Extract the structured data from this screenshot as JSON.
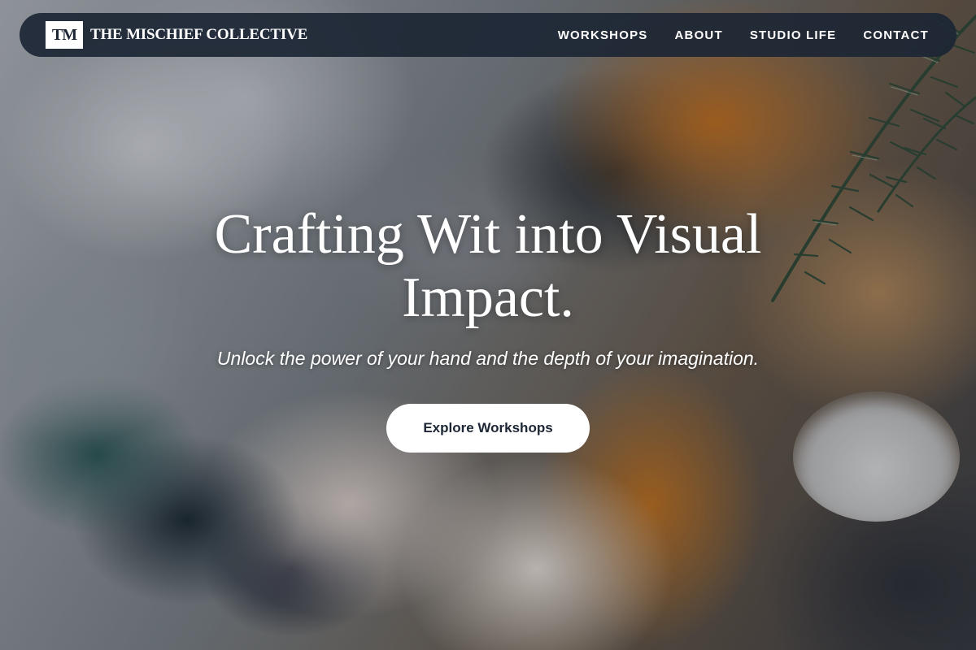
{
  "brand": {
    "logo_text": "TM",
    "name": "THE MISCHIEF COLLECTIVE"
  },
  "nav": {
    "items": [
      {
        "label": "WORKSHOPS"
      },
      {
        "label": "ABOUT"
      },
      {
        "label": "STUDIO LIFE"
      },
      {
        "label": "CONTACT"
      }
    ]
  },
  "hero": {
    "title_line1": "Crafting Wit into Visual",
    "title_line2": "Impact.",
    "subtitle": "Unlock the power of your hand and the depth of your imagination.",
    "cta_label": "Explore Workshops"
  },
  "colors": {
    "nav_background": "#1c2634",
    "cta_background": "#ffffff",
    "cta_text": "#1c2634"
  }
}
